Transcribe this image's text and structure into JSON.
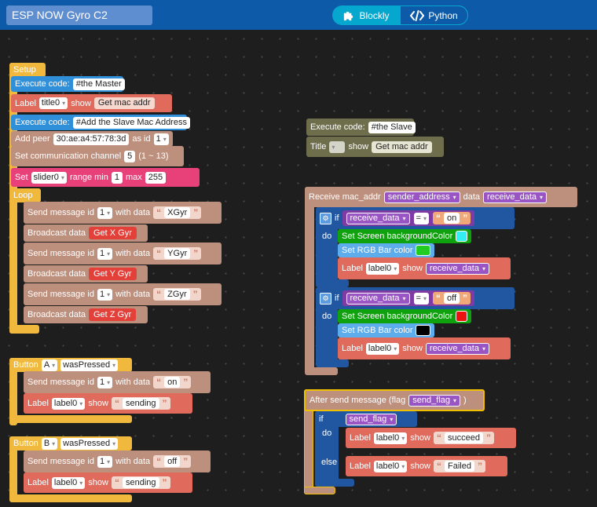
{
  "app": {
    "title": "ESP NOW Gyro C2"
  },
  "mode_toggle": {
    "blockly": "Blockly",
    "python": "Python"
  },
  "setup": {
    "hat": "Setup",
    "exec_label": "Execute code:",
    "exec1": "#the Master",
    "label_kw": "Label",
    "label_name": "title0",
    "show_kw": "show",
    "label_text": "Get mac addr",
    "exec2": "#Add the Slave Mac Address",
    "add_peer": "Add peer",
    "mac": "30:ae:a4:57:78:3d",
    "as_id": "as id",
    "id": "1",
    "set_channel": "Set communication channel",
    "channel": "5",
    "channel_range": "(1 ~ 13)",
    "set_kw": "Set",
    "slider": "slider0",
    "range_min": "range min",
    "min": "1",
    "max_kw": "max",
    "max": "255"
  },
  "loop": {
    "hat": "Loop",
    "send_kw": "Send message id",
    "with_data": "with data",
    "id": "1",
    "broadcast": "Broadcast data",
    "d1": "XGyr",
    "g1": "Get X Gyr",
    "d2": "YGyr",
    "g2": "Get Y Gyr",
    "d3": "ZGyr",
    "g3": "Get Z Gyr"
  },
  "btn_a": {
    "kw": "Button",
    "btn": "A",
    "event": "wasPressed",
    "send_kw": "Send message id",
    "id": "1",
    "with_data": "with data",
    "data": "on",
    "label_kw": "Label",
    "label_name": "label0",
    "show_kw": "show",
    "text": "sending"
  },
  "btn_b": {
    "kw": "Button",
    "btn": "B",
    "event": "wasPressed",
    "send_kw": "Send message id",
    "id": "1",
    "with_data": "with data",
    "data": "off",
    "label_kw": "Label",
    "label_name": "label0",
    "show_kw": "show",
    "text": "sending"
  },
  "slave": {
    "exec_label": "Execute code:",
    "exec": "#the Slave",
    "title_kw": "Title",
    "show_kw": "show",
    "text": "Get mac addr"
  },
  "receive": {
    "kw": "Receive mac_addr",
    "sender": "sender_address",
    "data_kw": "data",
    "data_var": "receive_data",
    "if_kw": "if",
    "do_kw": "do",
    "op": "=",
    "on": "on",
    "off": "off",
    "set_bg": "Set Screen backgroundColor",
    "set_rgb": "Set RGB Bar color",
    "label_kw": "Label",
    "label_name": "label0",
    "show_kw": "show",
    "color_cyan": "#33eef2",
    "color_green": "#22cc22",
    "color_red": "#ee1111",
    "color_black": "#000000"
  },
  "after_send": {
    "kw": "After send message (flag",
    "flag": "send_flag",
    "close": ")",
    "if_kw": "if",
    "do_kw": "do",
    "else_kw": "else",
    "label_kw": "Label",
    "label_name": "label0",
    "show_kw": "show",
    "succeed": "succeed",
    "failed": "Failed"
  }
}
